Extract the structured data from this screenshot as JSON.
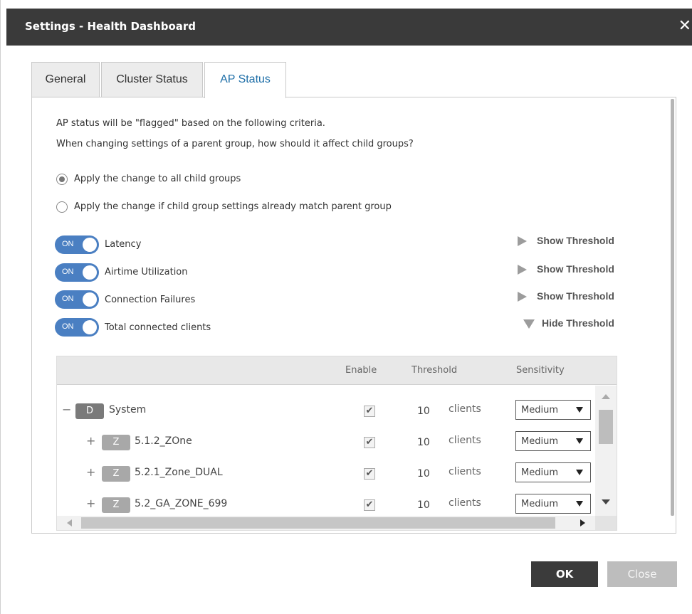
{
  "dialog": {
    "title": "Settings - Health Dashboard",
    "close_glyph": "✕"
  },
  "tabs": [
    {
      "label": "General"
    },
    {
      "label": "Cluster Status"
    },
    {
      "label": "AP Status",
      "active": true
    }
  ],
  "description": {
    "line1": "AP status will be \"flagged\" based on the following criteria.",
    "line2": "When changing settings of a parent group, how should it affect child groups?"
  },
  "radios": [
    {
      "label": "Apply the change to all child groups",
      "checked": true
    },
    {
      "label": "Apply the change if child group settings already match parent group",
      "checked": false
    }
  ],
  "criteria": [
    {
      "toggle": "ON",
      "label": "Latency",
      "threshold_link": "Show Threshold",
      "expanded": false
    },
    {
      "toggle": "ON",
      "label": "Airtime Utilization",
      "threshold_link": "Show Threshold",
      "expanded": false
    },
    {
      "toggle": "ON",
      "label": "Connection Failures",
      "threshold_link": "Show Threshold",
      "expanded": false
    },
    {
      "toggle": "ON",
      "label": "Total connected clients",
      "threshold_link": "Hide Threshold",
      "expanded": true
    }
  ],
  "table": {
    "headers": {
      "enable": "Enable",
      "threshold": "Threshold",
      "sensitivity": "Sensitivity"
    },
    "rows": [
      {
        "expander": "−",
        "badge": "D",
        "name": "System",
        "enabled": true,
        "threshold": "10",
        "unit": "clients",
        "sensitivity": "Medium"
      },
      {
        "expander": "+",
        "badge": "Z",
        "name": "5.1.2_ZOne",
        "enabled": true,
        "threshold": "10",
        "unit": "clients",
        "sensitivity": "Medium"
      },
      {
        "expander": "+",
        "badge": "Z",
        "name": "5.2.1_Zone_DUAL",
        "enabled": true,
        "threshold": "10",
        "unit": "clients",
        "sensitivity": "Medium"
      },
      {
        "expander": "+",
        "badge": "Z",
        "name": "5.2_GA_ZONE_699",
        "enabled": true,
        "threshold": "10",
        "unit": "clients",
        "sensitivity": "Medium"
      }
    ]
  },
  "buttons": {
    "ok": "OK",
    "close": "Close"
  },
  "colors": {
    "toggle_on": "#4a7fc2",
    "active_tab": "#1f6fa8",
    "titlebar": "#3a3a3a"
  }
}
